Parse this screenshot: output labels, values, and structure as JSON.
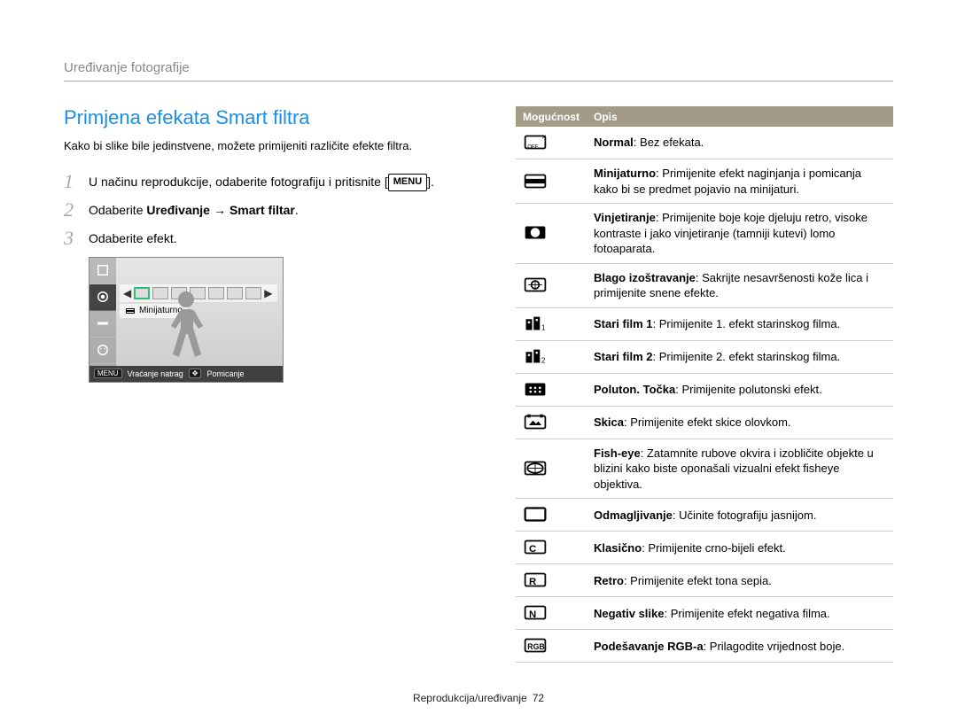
{
  "header": "Uređivanje fotografije",
  "title": "Primjena efekata Smart filtra",
  "intro": "Kako bi slike bile jedinstvene, možete primijeniti različite efekte filtra.",
  "steps": {
    "s1": "U načinu reprodukcije, odaberite fotografiju i pritisnite [",
    "s1_btn": "MENU",
    "s1_after": "].",
    "s2_pre": "Odaberite ",
    "s2_b1": "Uređivanje",
    "s2_arrow": "→",
    "s2_b2": "Smart filtar",
    "s2_after": ".",
    "s3": "Odaberite efekt."
  },
  "camshot": {
    "label": "Minijaturno",
    "footer_menu": "MENU",
    "footer_back": "Vraćanje natrag",
    "footer_move_k": "✥",
    "footer_move": "Pomicanje"
  },
  "table": {
    "h1": "Mogućnost",
    "h2": "Opis",
    "rows": [
      {
        "b": "Normal",
        "t": ": Bez efekata."
      },
      {
        "b": "Minijaturno",
        "t": ": Primijenite efekt naginjanja i pomicanja kako bi se predmet pojavio na minijaturi."
      },
      {
        "b": "Vinjetiranje",
        "t": ": Primijenite boje koje djeluju retro, visoke kontraste i jako vinjetiranje (tamniji kutevi) lomo fotoaparata."
      },
      {
        "b": "Blago izoštravanje",
        "t": ": Sakrijte nesavršenosti kože lica i primijenite snene efekte."
      },
      {
        "b": "Stari film 1",
        "t": ": Primijenite 1. efekt starinskog filma."
      },
      {
        "b": "Stari film 2",
        "t": ": Primijenite 2. efekt starinskog filma."
      },
      {
        "b": "Poluton. Točka",
        "t": ": Primijenite polutonski efekt."
      },
      {
        "b": "Skica",
        "t": ": Primijenite efekt skice olovkom."
      },
      {
        "b": "Fish-eye",
        "t": ": Zatamnite rubove okvira i izobličite objekte u blizini kako biste oponašali vizualni efekt fisheye objektiva."
      },
      {
        "b": "Odmagljivanje",
        "t": ": Učinite fotografiju jasnijom."
      },
      {
        "b": "Klasično",
        "t": ": Primijenite crno-bijeli efekt."
      },
      {
        "b": "Retro",
        "t": ": Primijenite efekt tona sepia."
      },
      {
        "b": "Negativ slike",
        "t": ": Primijenite efekt negativa filma."
      },
      {
        "b": "Podešavanje RGB-a",
        "t": ": Prilagodite vrijednost boje."
      }
    ]
  },
  "footer": {
    "text": "Reprodukcija/uređivanje",
    "page": "72"
  }
}
